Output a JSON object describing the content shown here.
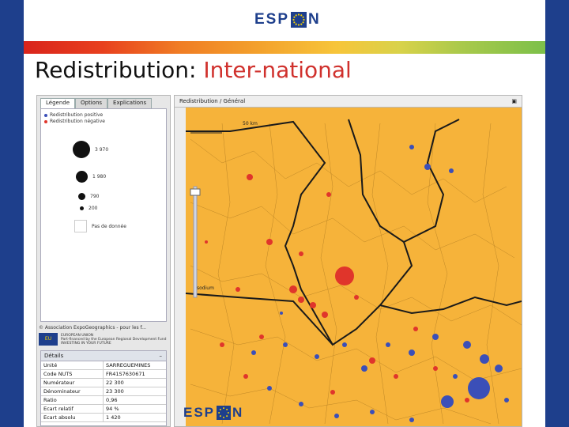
{
  "logo": {
    "text_left": "ESP",
    "text_right": "N"
  },
  "slide": {
    "title_main": "Redistribution: ",
    "title_accent": "Inter-national"
  },
  "left_panel": {
    "tabs": [
      {
        "label": "Légende"
      },
      {
        "label": "Options"
      },
      {
        "label": "Explications"
      }
    ],
    "legend": {
      "positive_label": "Redistribution positive",
      "negative_label": "Redistribution négative",
      "circles": [
        {
          "label": "3 970"
        },
        {
          "label": "1 980"
        },
        {
          "label": "790"
        },
        {
          "label": "200"
        }
      ],
      "no_data_label": "Pas de donnée",
      "colors": {
        "positive": "#3b4fb8",
        "negative": "#e0352b"
      }
    },
    "copyright": "© Association ExpoGeographics - pour les f...",
    "eu": {
      "flag_text": "EU",
      "line1": "EUROPEAN UNION",
      "line2": "Part-financed by the European Regional Development Fund",
      "line3": "INVESTING IN YOUR FUTURE"
    },
    "details": {
      "title": "Détails",
      "collapse_glyph": "–",
      "rows": [
        {
          "label": "Unité",
          "value": "SARREGUEMINES"
        },
        {
          "label": "Code NUTS",
          "value": "FR41S7630671"
        },
        {
          "label": "Numérateur",
          "value": "22 300"
        },
        {
          "label": "Dénominateur",
          "value": "23 300"
        },
        {
          "label": "Ratio",
          "value": "0,96"
        },
        {
          "label": "Ecart relatif",
          "value": "94 %"
        },
        {
          "label": "Ecart absolu",
          "value": "1 420"
        }
      ]
    }
  },
  "map_panel": {
    "title": "Redistribution / Général",
    "maximize_glyph": "▣",
    "scale_label": "50 km",
    "city_label": "sodium",
    "colors": {
      "land": "#f6b33a",
      "border": "#1a1a1a",
      "positive": "#3b4fb8",
      "negative": "#e0352b"
    }
  }
}
